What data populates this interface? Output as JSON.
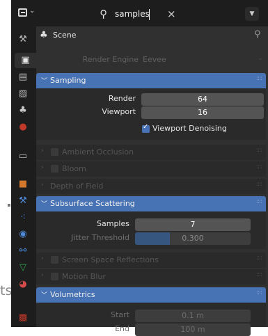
{
  "edge_text": "ts",
  "header": {
    "search_text": "samples"
  },
  "context": {
    "title": "Scene"
  },
  "render_engine": {
    "label": "Render Engine",
    "value": "Eevee"
  },
  "sampling": {
    "title": "Sampling",
    "render_label": "Render",
    "render_value": "64",
    "viewport_label": "Viewport",
    "viewport_value": "16",
    "denoise_label": "Viewport Denoising",
    "denoise_checked": true
  },
  "ambient_occlusion": {
    "title": "Ambient Occlusion"
  },
  "bloom": {
    "title": "Bloom"
  },
  "depth_of_field": {
    "title": "Depth of Field"
  },
  "subsurface": {
    "title": "Subsurface Scattering",
    "samples_label": "Samples",
    "samples_value": "7",
    "jitter_label": "Jitter Threshold",
    "jitter_value": "0.300",
    "jitter_fraction": 0.3
  },
  "ssr": {
    "title": "Screen Space Reflections"
  },
  "motion_blur": {
    "title": "Motion Blur"
  },
  "volumetrics": {
    "title": "Volumetrics",
    "start_label": "Start",
    "start_value": "0.1 m",
    "end_label": "End",
    "end_value": "100 m"
  },
  "colors": {
    "accent": "#4772b3",
    "panel": "#303030",
    "background": "#1d1d1d"
  }
}
